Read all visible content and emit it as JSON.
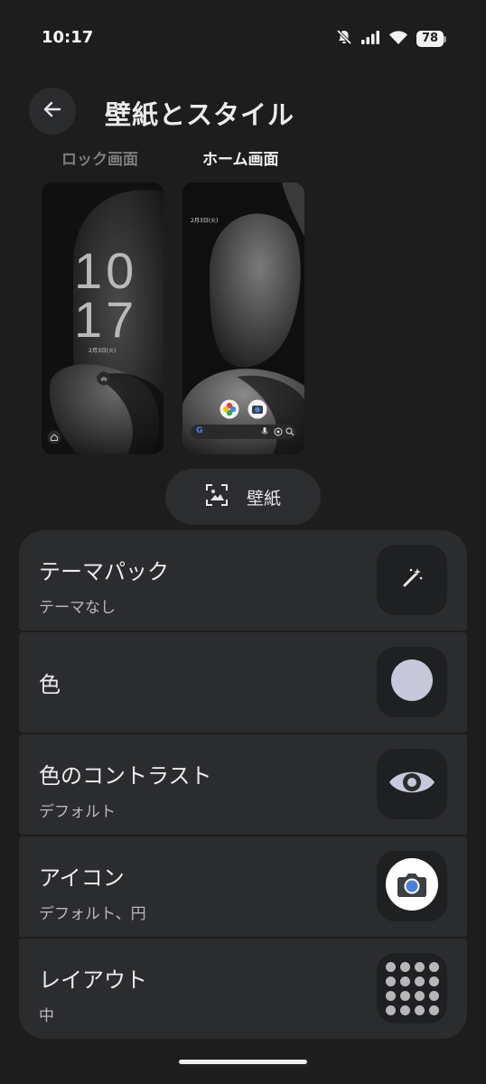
{
  "status_bar": {
    "time": "10:17",
    "battery": "78"
  },
  "header": {
    "title": "壁紙とスタイル"
  },
  "preview_tabs": [
    {
      "label": "ロック画面",
      "selected": false
    },
    {
      "label": "ホーム画面",
      "selected": true
    }
  ],
  "lock_preview": {
    "clock_hour": "10",
    "clock_minute": "17",
    "date": "2月3日(火)"
  },
  "home_preview": {
    "date": "2月3日(火)",
    "search_logo": "G"
  },
  "wallpaper_button": {
    "label": "壁紙"
  },
  "settings": [
    {
      "title": "テーマパック",
      "subtitle": "テーマなし",
      "icon": "magic-wand-icon"
    },
    {
      "title": "色",
      "subtitle": "",
      "icon": "color-swatch-icon",
      "swatch_color": "#c7c8d9"
    },
    {
      "title": "色のコントラスト",
      "subtitle": "デフォルト",
      "icon": "eye-icon"
    },
    {
      "title": "アイコン",
      "subtitle": "デフォルト、円",
      "icon": "camera-icon"
    },
    {
      "title": "レイアウト",
      "subtitle": "中",
      "icon": "grid-dots-icon"
    }
  ],
  "colors": {
    "background": "#1d1d1e",
    "card": "#2b2c2e",
    "icon_box": "#1f2021",
    "accent_blue": "#4a7fde"
  }
}
